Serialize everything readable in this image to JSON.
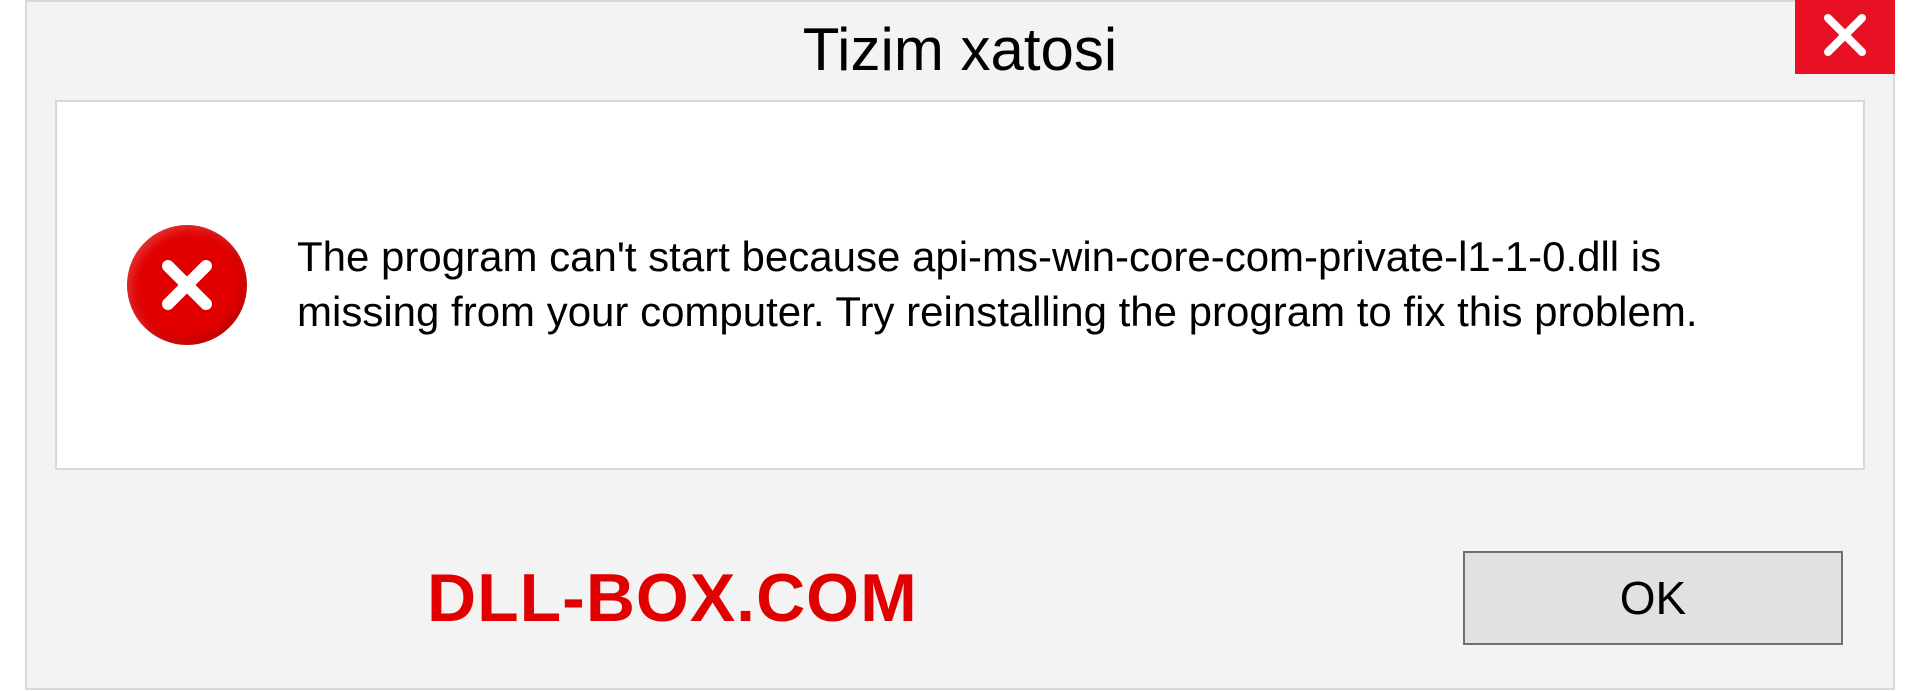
{
  "dialog": {
    "title": "Tizim xatosi",
    "message": "The program can't start because api-ms-win-core-com-private-l1-1-0.dll is missing from your computer. Try reinstalling the program to fix this problem.",
    "ok_label": "OK"
  },
  "watermark": "DLL-BOX.COM",
  "colors": {
    "close_bg": "#e81123",
    "error_icon": "#e00000",
    "watermark": "#e00000"
  }
}
